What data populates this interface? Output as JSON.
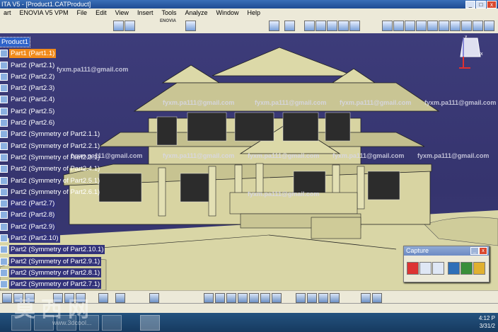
{
  "window": {
    "title": "ITA V5 - [Product1.CATProduct]"
  },
  "menu": [
    "art",
    "ENOVIA V5 VPM",
    "File",
    "Edit",
    "View",
    "Insert",
    "Tools",
    "Analyze",
    "Window",
    "Help"
  ],
  "toolbar": {
    "enovia_logo": "ENOVIA",
    "search_placeholder": "..."
  },
  "tree": {
    "items": [
      {
        "label": "Product1",
        "state": "root"
      },
      {
        "label": "Part1 (Part1.1)",
        "state": "selected"
      },
      {
        "label": "Part2 (Part2.1)",
        "state": "normal"
      },
      {
        "label": "Part2 (Part2.2)",
        "state": "normal"
      },
      {
        "label": "Part2 (Part2.3)",
        "state": "normal"
      },
      {
        "label": "Part2 (Part2.4)",
        "state": "normal"
      },
      {
        "label": "Part2 (Part2.5)",
        "state": "normal"
      },
      {
        "label": "Part2 (Part2.6)",
        "state": "normal"
      },
      {
        "label": "Part2 (Symmetry of Part2.1.1)",
        "state": "normal"
      },
      {
        "label": "Part2 (Symmetry of Part2.2.1)",
        "state": "normal"
      },
      {
        "label": "Part2 (Symmetry of Part2.3.1)",
        "state": "normal"
      },
      {
        "label": "Part2 (Symmetry of Part2.4.1)",
        "state": "normal"
      },
      {
        "label": "Part2 (Symmetry of Part2.5.1)",
        "state": "normal"
      },
      {
        "label": "Part2 (Symmetry of Part2.6.1)",
        "state": "normal"
      },
      {
        "label": "Part2 (Part2.7)",
        "state": "highlight"
      },
      {
        "label": "Part2 (Part2.8)",
        "state": "highlight"
      },
      {
        "label": "Part2 (Part2.9)",
        "state": "highlight"
      },
      {
        "label": "Part2 (Part2.10)",
        "state": "highlight"
      },
      {
        "label": "Part2 (Symmetry of Part2.10.1)",
        "state": "highlight"
      },
      {
        "label": "Part2 (Symmetry of Part2.9.1)",
        "state": "highlight"
      },
      {
        "label": "Part2 (Symmetry of Part2.8.1)",
        "state": "highlight"
      },
      {
        "label": "Part2 (Symmetry of Part2.7.1)",
        "state": "highlight"
      }
    ]
  },
  "watermarks": [
    "fyxm.pa111@gmail.com"
  ],
  "capture": {
    "title": "Capture"
  },
  "taskbar": {
    "clock_time": "4:12 P",
    "clock_date": "3/31/2"
  },
  "site_watermark": {
    "big": "莫西网",
    "url": "www.3dcool..."
  },
  "compass": {
    "axis_x": "x",
    "axis_y": "y"
  },
  "colors": {
    "viewport": "#3b3a78",
    "model": "#d9d6a6",
    "selected": "#f08a1a",
    "root": "#2f63c9"
  }
}
